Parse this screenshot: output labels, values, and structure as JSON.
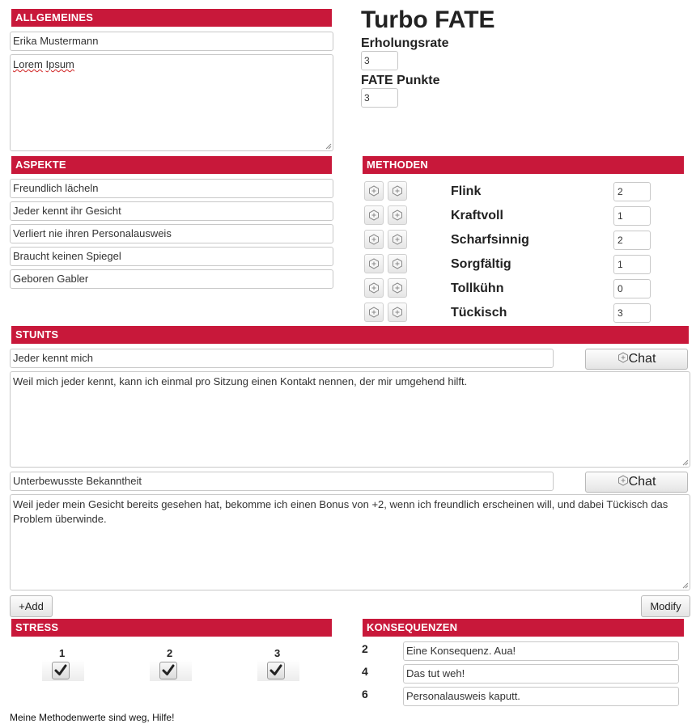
{
  "sections": {
    "allgemeines": "ALLGEMEINES",
    "aspekte": "ASPEKTE",
    "methoden": "METHODEN",
    "stunts": "STUNTS",
    "stress": "STRESS",
    "konsequenzen": "KONSEQUENZEN"
  },
  "general": {
    "name": "Erika Mustermann",
    "description_word1": "Lorem",
    "description_word2": "Ipsum"
  },
  "header": {
    "title": "Turbo FATE",
    "refresh_label": "Erholungsrate",
    "refresh_value": "3",
    "fate_points_label": "FATE Punkte",
    "fate_points_value": "3"
  },
  "aspects": [
    "Freundlich lächeln",
    "Jeder kennt ihr Gesicht",
    "Verliert nie ihren Personalausweis",
    "Braucht keinen Spiegel",
    "Geboren Gabler"
  ],
  "approaches": [
    {
      "name": "Flink",
      "value": "2"
    },
    {
      "name": "Kraftvoll",
      "value": "1"
    },
    {
      "name": "Scharfsinnig",
      "value": "2"
    },
    {
      "name": "Sorgfältig",
      "value": "1"
    },
    {
      "name": "Tollkühn",
      "value": "0"
    },
    {
      "name": "Tückisch",
      "value": "3"
    }
  ],
  "stunts": [
    {
      "name": "Jeder kennt mich",
      "description": "Weil mich jeder kennt, kann ich einmal pro Sitzung einen Kontakt nennen, der mir umgehend hilft.",
      "chat_label": "Chat"
    },
    {
      "name": "Unterbewusste Bekanntheit",
      "description": "Weil jeder mein Gesicht bereits gesehen hat, bekomme ich einen Bonus von +2, wenn ich freundlich erscheinen will, und dabei Tückisch das Problem überwinde.",
      "chat_label": "Chat"
    }
  ],
  "buttons": {
    "add": "+Add",
    "modify": "Modify"
  },
  "stress": [
    {
      "label": "1",
      "checked": true
    },
    {
      "label": "2",
      "checked": true
    },
    {
      "label": "3",
      "checked": true
    }
  ],
  "consequences": [
    {
      "level": "2",
      "text": "Eine Konsequenz. Aua!"
    },
    {
      "level": "4",
      "text": "Das tut weh!"
    },
    {
      "level": "6",
      "text": "Personalausweis kaputt."
    }
  ],
  "footer_note": "Meine Methodenwerte sind weg, Hilfe!",
  "colors": {
    "section_bar": "#c8183a"
  },
  "icons": {
    "die": "fate-die-icon",
    "check": "checkmark-icon",
    "resize": "resize-grip-icon"
  }
}
